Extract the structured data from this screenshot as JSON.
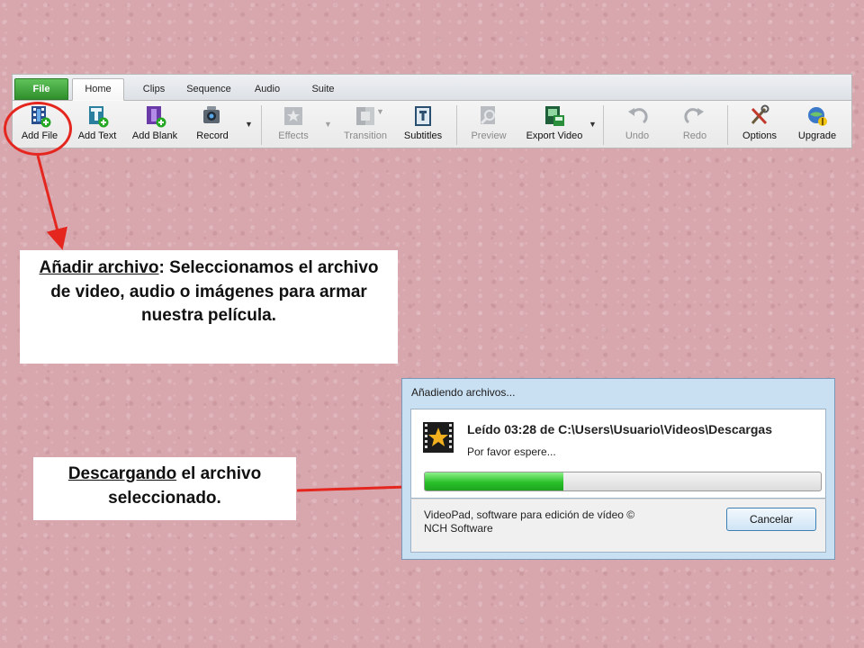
{
  "ribbon": {
    "tabs": [
      {
        "label": "File"
      },
      {
        "label": "Home"
      },
      {
        "label": "Clips"
      },
      {
        "label": "Sequence"
      },
      {
        "label": "Audio"
      },
      {
        "label": "Suite"
      }
    ],
    "tools": {
      "add_file": "Add File",
      "add_text": "Add Text",
      "add_blank": "Add Blank",
      "record": "Record",
      "effects": "Effects",
      "transition": "Transition",
      "subtitles": "Subtitles",
      "preview": "Preview",
      "export_video": "Export Video",
      "undo": "Undo",
      "redo": "Redo",
      "options": "Options",
      "upgrade": "Upgrade"
    }
  },
  "callout_add_file": {
    "term": "Añadir archivo",
    "text": ": Seleccionamos el archivo de video, audio o imágenes para armar nuestra película."
  },
  "callout_download": {
    "term": "Descargando",
    "text": " el archivo seleccionado."
  },
  "dialog": {
    "title": "Añadiendo archivos...",
    "status": "Leído 03:28 de C:\\Users\\Usuario\\Videos\\Descargas",
    "wait": "Por favor espere...",
    "progress": 0.35,
    "copyright": "VideoPad, software para edición de vídeo © NCH Software",
    "cancel": "Cancelar"
  },
  "colors": {
    "background": "#d8a6ad",
    "highlight": "#e4261f",
    "progress_green": "#29c12a",
    "file_tab_green": "#2f8f2c"
  }
}
